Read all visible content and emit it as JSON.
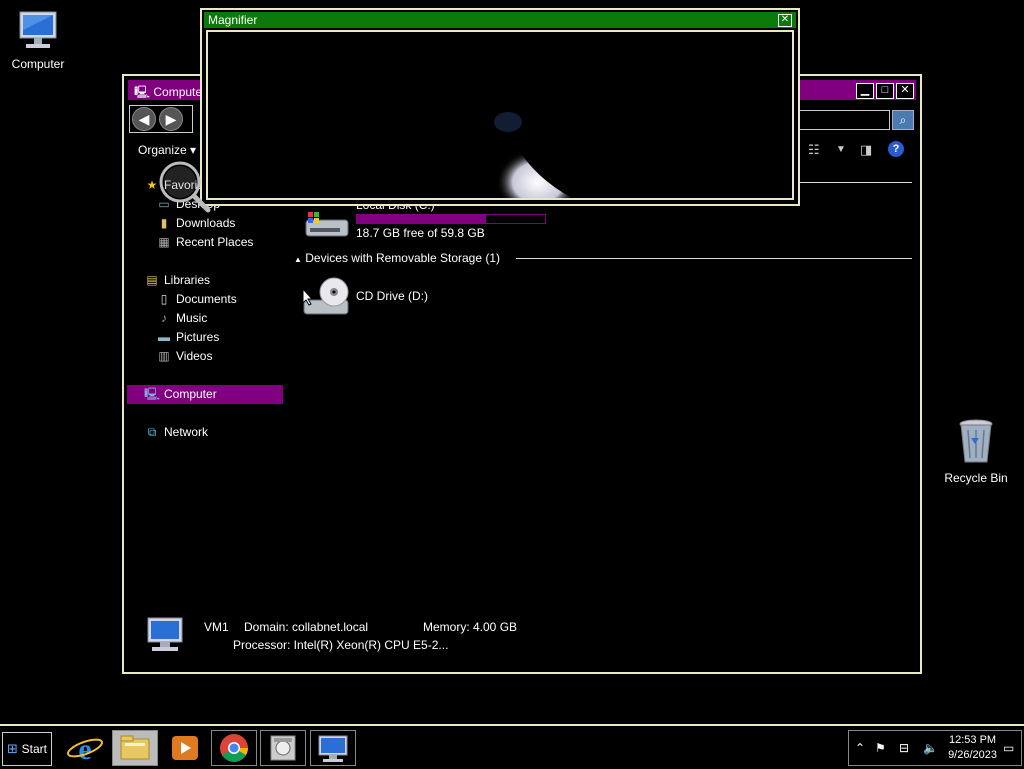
{
  "desktop": {
    "computer_label": "Computer",
    "recycle_label": "Recycle Bin"
  },
  "explorer": {
    "title": "Computer",
    "organize_label": "Organize",
    "sidebar": {
      "favorites": "Favorites",
      "desktop": "Desktop",
      "downloads": "Downloads",
      "recent_places": "Recent Places",
      "libraries": "Libraries",
      "documents": "Documents",
      "music": "Music",
      "pictures": "Pictures",
      "videos": "Videos",
      "computer": "Computer",
      "network": "Network"
    },
    "local_disk": {
      "name": "Local Disk (C:)",
      "free_text": "18.7 GB free of 59.8 GB",
      "used_fraction": 0.687
    },
    "removable_header": "Devices with Removable Storage (1)",
    "cd_drive": "CD Drive (D:)",
    "details": {
      "name": "VM1",
      "domain": "Domain: collabnet.local",
      "memory": "Memory: 4.00 GB",
      "processor": "Processor: Intel(R) Xeon(R) CPU E5-2..."
    }
  },
  "magnifier": {
    "title": "Magnifier"
  },
  "taskbar": {
    "start_label": "Start",
    "time": "12:53 PM",
    "date": "9/26/2023"
  },
  "colors": {
    "accent": "#800080",
    "magnifier_title": "#0b7a0b",
    "border": "#e8e8c8"
  }
}
